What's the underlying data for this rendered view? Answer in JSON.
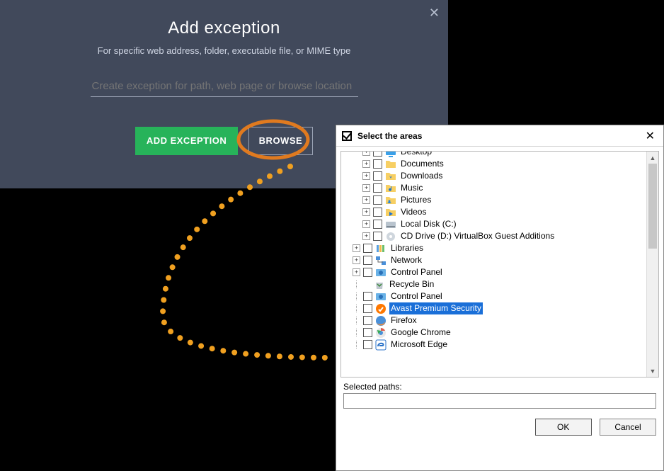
{
  "exception_panel": {
    "title": "Add exception",
    "subtitle": "For specific web address, folder, executable file, or MIME type",
    "input_placeholder": "Create exception for path, web page or browse location",
    "input_value": "",
    "add_label": "ADD EXCEPTION",
    "browse_label": "BROWSE"
  },
  "select_dialog": {
    "title": "Select the areas",
    "selected_paths_label": "Selected paths:",
    "selected_paths_value": "",
    "ok_label": "OK",
    "cancel_label": "Cancel",
    "tree": [
      {
        "indent": 2,
        "expand": "+",
        "checkbox": true,
        "icon": "desktop",
        "label": "Desktop"
      },
      {
        "indent": 2,
        "expand": "+",
        "checkbox": true,
        "icon": "folder",
        "label": "Documents"
      },
      {
        "indent": 2,
        "expand": "+",
        "checkbox": true,
        "icon": "downloads",
        "label": "Downloads"
      },
      {
        "indent": 2,
        "expand": "+",
        "checkbox": true,
        "icon": "music",
        "label": "Music"
      },
      {
        "indent": 2,
        "expand": "+",
        "checkbox": true,
        "icon": "pictures",
        "label": "Pictures"
      },
      {
        "indent": 2,
        "expand": "+",
        "checkbox": true,
        "icon": "videos",
        "label": "Videos"
      },
      {
        "indent": 2,
        "expand": "+",
        "checkbox": true,
        "icon": "disk",
        "label": "Local Disk (C:)"
      },
      {
        "indent": 2,
        "expand": "+",
        "checkbox": true,
        "icon": "cd",
        "label": "CD Drive (D:) VirtualBox Guest Additions"
      },
      {
        "indent": 1,
        "expand": "+",
        "checkbox": true,
        "icon": "libraries",
        "label": "Libraries"
      },
      {
        "indent": 1,
        "expand": "+",
        "checkbox": true,
        "icon": "network",
        "label": "Network"
      },
      {
        "indent": 1,
        "expand": "+",
        "checkbox": true,
        "icon": "cpanel",
        "label": "Control Panel"
      },
      {
        "indent": 1,
        "expand": "",
        "checkbox": false,
        "icon": "recycle",
        "label": "Recycle Bin"
      },
      {
        "indent": 1,
        "expand": "",
        "checkbox": true,
        "icon": "cpanel",
        "label": "Control Panel"
      },
      {
        "indent": 1,
        "expand": "",
        "checkbox": true,
        "icon": "avast",
        "label": "Avast Premium Security",
        "selected": true
      },
      {
        "indent": 1,
        "expand": "",
        "checkbox": true,
        "icon": "firefox",
        "label": "Firefox"
      },
      {
        "indent": 1,
        "expand": "",
        "checkbox": true,
        "icon": "chrome",
        "label": "Google Chrome"
      },
      {
        "indent": 1,
        "expand": "",
        "checkbox": true,
        "icon": "edge",
        "label": "Microsoft Edge"
      }
    ]
  }
}
